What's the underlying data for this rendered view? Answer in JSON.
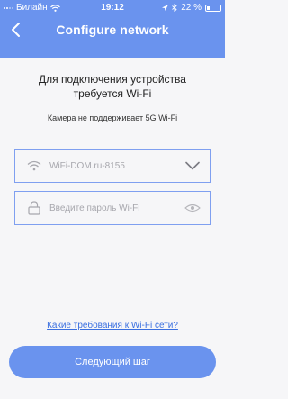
{
  "statusbar": {
    "carrier": "Билайн",
    "time": "19:12",
    "battery": "22 %"
  },
  "nav": {
    "title": "Configure network",
    "back_icon": "chevron-left-icon"
  },
  "content": {
    "headline": "Для подключения устройства требуется Wi-Fi",
    "subline": "Камера не поддерживает 5G Wi-Fi"
  },
  "wifi_field": {
    "value": "WiFi-DOM.ru-8155",
    "icon": "wifi-icon",
    "dropdown_icon": "chevron-down-icon"
  },
  "password_field": {
    "placeholder": "Введите пароль Wi-Fi",
    "icon": "lock-icon",
    "toggle_icon": "eye-icon"
  },
  "link": {
    "requirements": "Какие требования к Wi-Fi сети?"
  },
  "button": {
    "next": "Следующий шаг"
  },
  "colors": {
    "accent": "#6a93ee",
    "link": "#3a6fe0",
    "background": "#f6f6f8"
  }
}
